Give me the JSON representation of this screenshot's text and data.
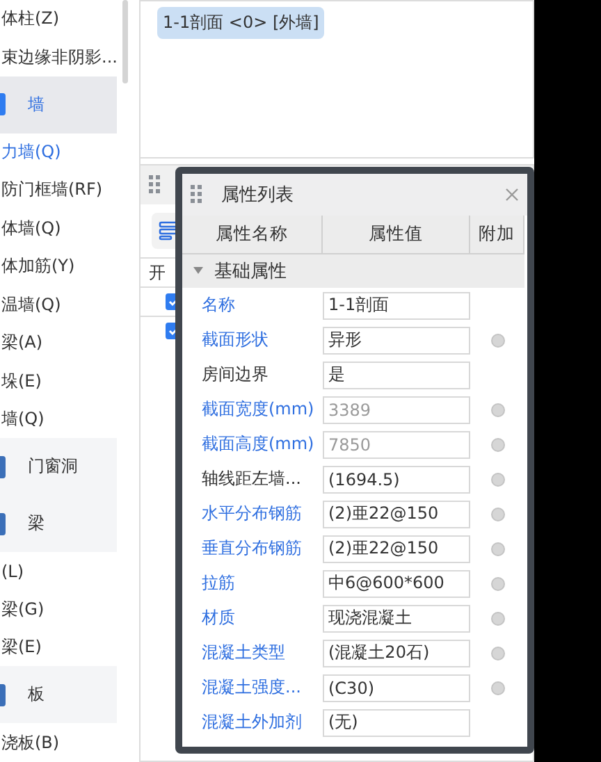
{
  "sidebar": {
    "items": [
      {
        "kind": "item",
        "label": "体柱(Z)",
        "selected": false
      },
      {
        "kind": "item",
        "label": "束边缘非阴影...",
        "selected": false
      },
      {
        "kind": "category",
        "label": "墙",
        "selected": true
      },
      {
        "kind": "item",
        "label": "力墙(Q)",
        "selected": true
      },
      {
        "kind": "item",
        "label": "防门框墙(RF)",
        "selected": false
      },
      {
        "kind": "item",
        "label": "体墙(Q)",
        "selected": false
      },
      {
        "kind": "item",
        "label": "体加筋(Y)",
        "selected": false
      },
      {
        "kind": "item",
        "label": "温墙(Q)",
        "selected": false
      },
      {
        "kind": "item",
        "label": "梁(A)",
        "selected": false
      },
      {
        "kind": "item",
        "label": "垛(E)",
        "selected": false
      },
      {
        "kind": "item",
        "label": "墙(Q)",
        "selected": false
      },
      {
        "kind": "category",
        "label": "门窗洞",
        "selected": false
      },
      {
        "kind": "category",
        "label": "梁",
        "selected": false
      },
      {
        "kind": "item",
        "label": "(L)",
        "selected": false
      },
      {
        "kind": "item",
        "label": "梁(G)",
        "selected": false
      },
      {
        "kind": "item",
        "label": "梁(E)",
        "selected": false
      },
      {
        "kind": "category",
        "label": "板",
        "selected": false
      },
      {
        "kind": "item",
        "label": "浇板(B)",
        "selected": false
      }
    ]
  },
  "component_panel": {
    "tag": "1-1剖面 <0> [外墙]"
  },
  "lower_panel": {
    "column_1": "开",
    "rows": [
      {
        "checked": true
      },
      {
        "checked": true
      }
    ]
  },
  "property_dialog": {
    "title": "属性列表",
    "columns": [
      "属性名称",
      "属性值",
      "附加"
    ],
    "group": {
      "label": "基础属性",
      "expanded": true
    },
    "rows": [
      {
        "name": "名称",
        "value": "1-1剖面",
        "public": true,
        "disabled": false,
        "attach": false
      },
      {
        "name": "截面形状",
        "value": "异形",
        "public": true,
        "disabled": false,
        "attach": true
      },
      {
        "name": "房间边界",
        "value": "是",
        "public": false,
        "disabled": false,
        "attach": false
      },
      {
        "name": "截面宽度(mm)",
        "value": "3389",
        "public": true,
        "disabled": true,
        "attach": true
      },
      {
        "name": "截面高度(mm)",
        "value": "7850",
        "public": true,
        "disabled": true,
        "attach": true
      },
      {
        "name": "轴线距左墙...",
        "value": "(1694.5)",
        "public": false,
        "disabled": false,
        "attach": true
      },
      {
        "name": "水平分布钢筋",
        "value": "(2)亜22@150",
        "public": true,
        "disabled": false,
        "attach": true
      },
      {
        "name": "垂直分布钢筋",
        "value": "(2)亜22@150",
        "public": true,
        "disabled": false,
        "attach": true
      },
      {
        "name": "拉筋",
        "value": "中6@600*600",
        "public": true,
        "disabled": false,
        "attach": true
      },
      {
        "name": "材质",
        "value": "现浇混凝土",
        "public": true,
        "disabled": false,
        "attach": true
      },
      {
        "name": "混凝土类型",
        "value": "(混凝土20石)",
        "public": true,
        "disabled": false,
        "attach": true
      },
      {
        "name": "混凝土强度...",
        "value": "(C30)",
        "public": true,
        "disabled": false,
        "attach": true
      },
      {
        "name": "混凝土外加剂",
        "value": "(无)",
        "public": true,
        "disabled": false,
        "attach": false
      }
    ]
  }
}
